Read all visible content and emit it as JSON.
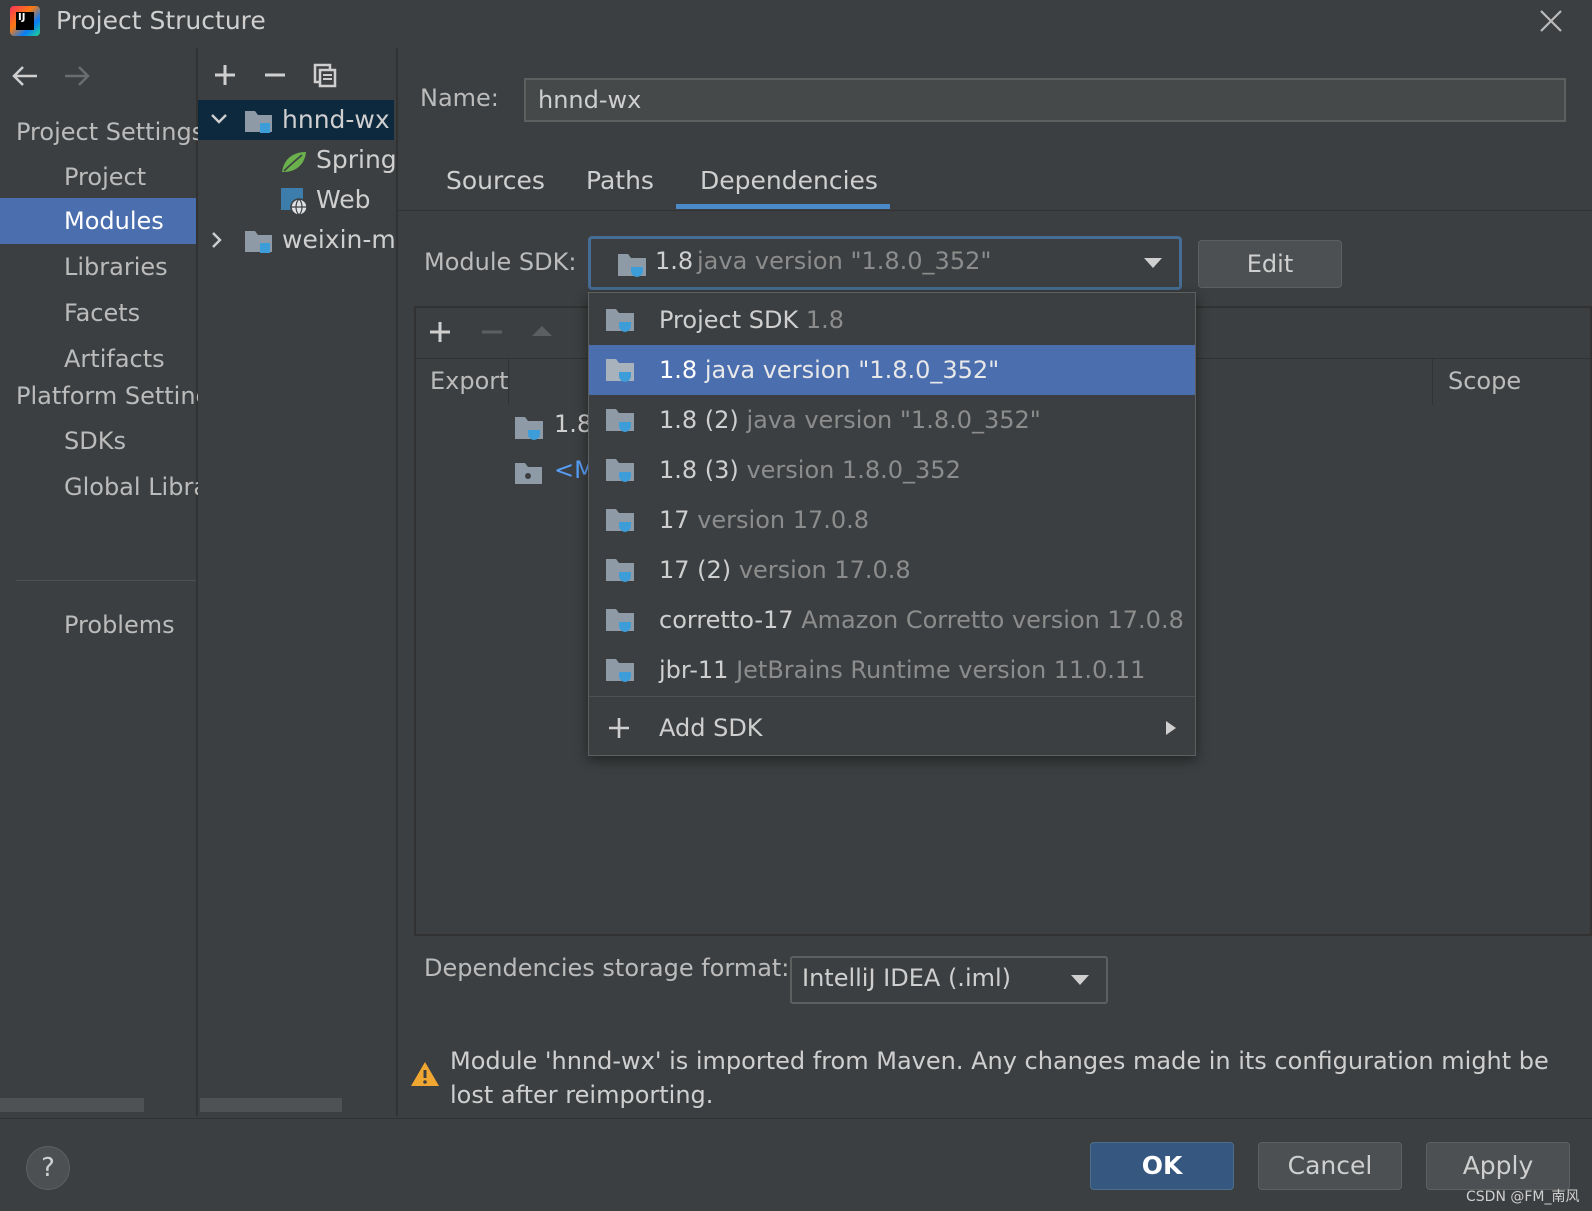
{
  "window": {
    "title": "Project Structure"
  },
  "nav": {
    "sections": [
      {
        "header": "Project Settings",
        "items": [
          "Project",
          "Modules",
          "Libraries",
          "Facets",
          "Artifacts"
        ]
      },
      {
        "header": "Platform Setting",
        "items": [
          "SDKs",
          "Global Libra"
        ]
      }
    ],
    "problems": "Problems",
    "selected": "Modules"
  },
  "tree": {
    "nodes": [
      {
        "label": "hnnd-wx",
        "expanded": true
      },
      {
        "label": "Spring"
      },
      {
        "label": "Web"
      },
      {
        "label": "weixin-me",
        "expanded": false
      }
    ]
  },
  "module": {
    "name_label": "Name:",
    "name_value": "hnnd-wx",
    "tabs": [
      "Sources",
      "Paths",
      "Dependencies"
    ],
    "active_tab": "Dependencies"
  },
  "sdk": {
    "label": "Module SDK:",
    "selected_name": "1.8",
    "selected_detail": "java version \"1.8.0_352\"",
    "edit_label": "Edit",
    "options": [
      {
        "name": "Project SDK",
        "detail": "1.8"
      },
      {
        "name": "1.8",
        "detail": "java version \"1.8.0_352\""
      },
      {
        "name": "1.8 (2)",
        "detail": "java version \"1.8.0_352\""
      },
      {
        "name": "1.8 (3)",
        "detail": "version 1.8.0_352"
      },
      {
        "name": "17",
        "detail": "version 17.0.8"
      },
      {
        "name": "17 (2)",
        "detail": "version 17.0.8"
      },
      {
        "name": "corretto-17",
        "detail": "Amazon Corretto version 17.0.8"
      },
      {
        "name": "jbr-11",
        "detail": "JetBrains Runtime version 11.0.11"
      }
    ],
    "add_sdk": "Add SDK"
  },
  "deps": {
    "headers": {
      "export": "Export",
      "scope": "Scope"
    },
    "rows": [
      "1.8",
      "<M"
    ]
  },
  "storage": {
    "label": "Dependencies storage format:",
    "value": "IntelliJ IDEA (.iml)"
  },
  "warning": {
    "text": "Module 'hnnd-wx' is imported from Maven. Any changes made in its configuration might be lost after reimporting."
  },
  "buttons": {
    "help": "?",
    "ok": "OK",
    "cancel": "Cancel",
    "apply": "Apply"
  },
  "watermark": "CSDN @FM_南风",
  "colors": {
    "accent": "#4b6eaf",
    "tab_underline": "#4a88c7",
    "sdk_icon": "#3d9dd9",
    "warning": "#f0a732"
  }
}
